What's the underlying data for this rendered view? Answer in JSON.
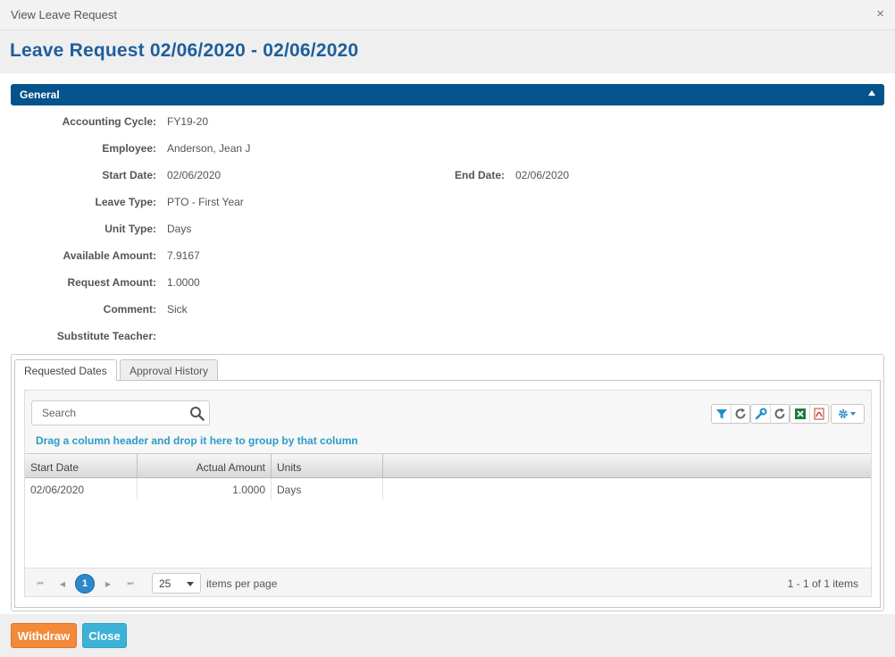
{
  "window": {
    "title": "View Leave Request",
    "close_glyph": "×"
  },
  "page": {
    "heading": "Leave Request 02/06/2020 - 02/06/2020"
  },
  "section": {
    "label": "General"
  },
  "fields": {
    "accounting_cycle": {
      "label": "Accounting Cycle:",
      "value": "FY19-20"
    },
    "employee": {
      "label": "Employee:",
      "value": "Anderson, Jean J"
    },
    "start_date": {
      "label": "Start Date:",
      "value": "02/06/2020"
    },
    "end_date": {
      "label": "End Date:",
      "value": "02/06/2020"
    },
    "leave_type": {
      "label": "Leave Type:",
      "value": "PTO - First Year"
    },
    "unit_type": {
      "label": "Unit Type:",
      "value": "Days"
    },
    "available_amount": {
      "label": "Available Amount:",
      "value": "7.9167"
    },
    "request_amount": {
      "label": "Request Amount:",
      "value": "1.0000"
    },
    "comment": {
      "label": "Comment:",
      "value": "Sick"
    },
    "substitute_teacher": {
      "label": "Substitute Teacher:",
      "value": ""
    }
  },
  "tabs": [
    {
      "label": "Requested Dates",
      "active": true
    },
    {
      "label": "Approval History",
      "active": false
    }
  ],
  "grid": {
    "search_placeholder": "Search",
    "group_hint": "Drag a column header and drop it here to group by that column",
    "toolbar_icons": [
      "filter-icon",
      "refresh-icon",
      "wrench-icon",
      "refresh-icon",
      "excel-icon",
      "pdf-icon",
      "gear-icon"
    ],
    "columns": [
      "Start Date",
      "Actual Amount",
      "Units"
    ],
    "rows": [
      {
        "start_date": "02/06/2020",
        "actual_amount": "1.0000",
        "units": "Days"
      }
    ],
    "pager": {
      "first": "⏮",
      "prev": "◀",
      "current_page": "1",
      "next": "▶",
      "last": "⏭",
      "page_size": "25",
      "items_per_page_label": "items per page",
      "info": "1 - 1 of 1 items"
    }
  },
  "footer": {
    "withdraw_label": "Withdraw",
    "close_label": "Close"
  },
  "colors": {
    "accent_blue": "#05538d",
    "heading_blue": "#1e5f9c",
    "withdraw_orange": "#f28a3a",
    "close_cyan": "#3cb2d6",
    "hint_cyan": "#2a9cc7"
  }
}
